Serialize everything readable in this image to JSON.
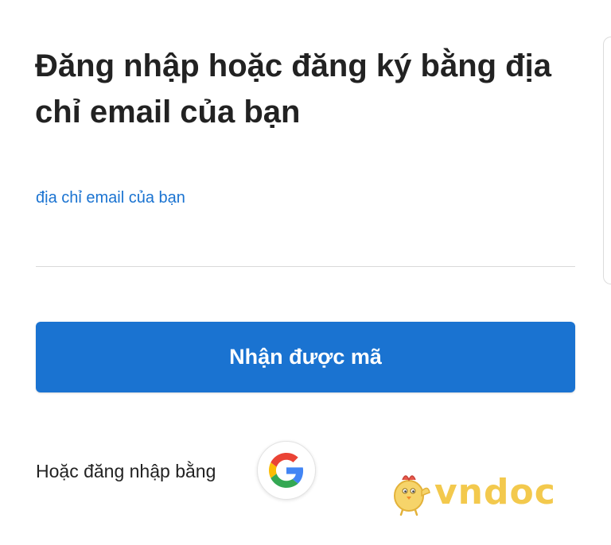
{
  "login": {
    "title": "Đăng nhập hoặc đăng ký bằng địa chỉ email của bạn",
    "email_field": {
      "label": "địa chỉ email của bạn",
      "value": "",
      "placeholder": ""
    },
    "submit_label": "Nhận được mã",
    "alt_login_text": "Hoặc đăng nhập bằng",
    "social_icon": "google-icon"
  },
  "watermark": {
    "text": "vndoc",
    "mascot_icon": "chicken-mascot-icon"
  },
  "colors": {
    "accent": "#1a73d1",
    "text": "#222222",
    "divider": "#d9d9d9",
    "watermark": "#f3c94d",
    "google_blue": "#4285F4",
    "google_red": "#EA4335",
    "google_yellow": "#FBBC05",
    "google_green": "#34A853"
  }
}
